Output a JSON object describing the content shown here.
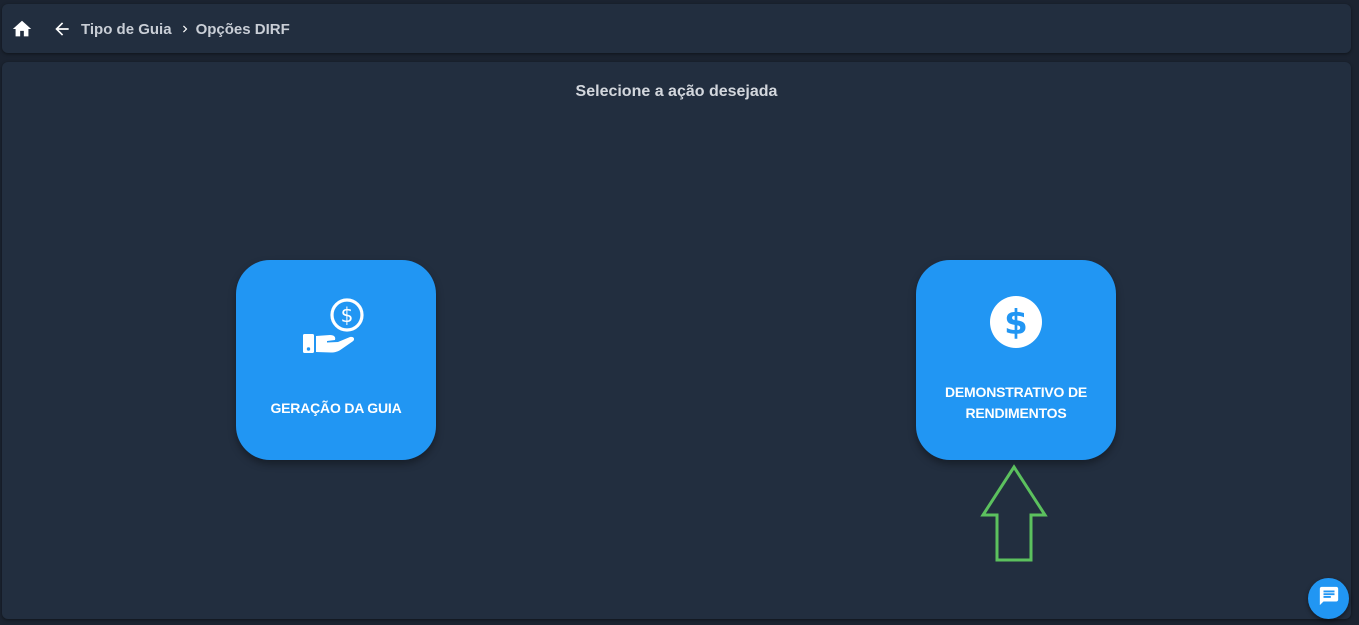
{
  "header": {
    "home_icon": "home-icon",
    "back_icon": "arrow-left-icon",
    "breadcrumb": {
      "parent": "Tipo de Guia",
      "separator_icon": "chevron-right-icon",
      "current": "Opções DIRF"
    }
  },
  "main": {
    "title": "Selecione a ação desejada",
    "actions": [
      {
        "icon": "hand-coin-icon",
        "label": "GERAÇÃO DA GUIA"
      },
      {
        "icon": "dollar-circle-icon",
        "label_line1": "DEMONSTRATIVO DE",
        "label_line2": "RENDIMENTOS"
      }
    ]
  },
  "annotation": {
    "arrow_color": "#5cc15e"
  },
  "chat": {
    "icon": "chat-icon"
  },
  "colors": {
    "background": "#1b2330",
    "surface": "#222e3f",
    "accent": "#2196f3",
    "text": "#d3d7dd"
  }
}
